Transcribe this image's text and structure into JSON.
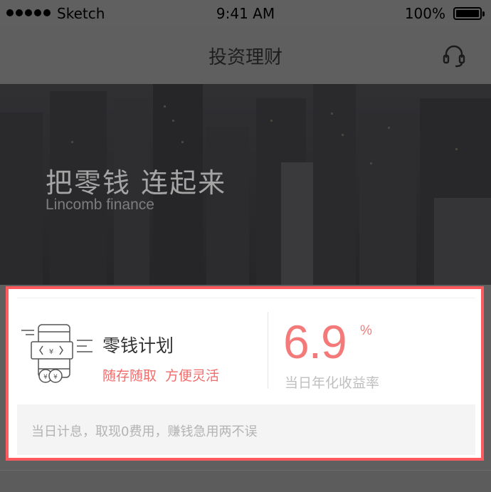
{
  "status_bar": {
    "carrier": "Sketch",
    "time": "9:41 AM",
    "battery": "100%"
  },
  "nav": {
    "title": "投资理财",
    "icon": "headset-icon"
  },
  "banner": {
    "title": "把零钱 连起来",
    "subtitle": "Lincomb finance"
  },
  "product": {
    "name": "零钱计划",
    "tags": [
      "随存随取",
      "方便灵活"
    ],
    "rate": "6.9",
    "rate_unit": "%",
    "rate_label": "当日年化收益率",
    "note": "当日计息，取现0费用，赚钱急用两不误",
    "accent_color": "#f26b6b",
    "highlight_color": "#ff5b5f"
  }
}
